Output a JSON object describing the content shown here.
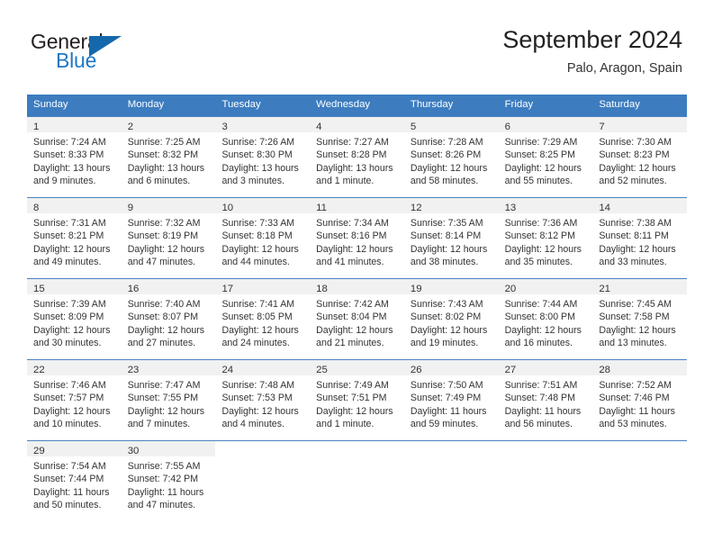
{
  "brand": {
    "name_top": "General",
    "name_bottom": "Blue",
    "triangle_color": "#1668ad",
    "blue_color": "#1f77c4"
  },
  "header": {
    "title": "September 2024",
    "subtitle": "Palo, Aragon, Spain"
  },
  "theme": {
    "header_blue": "#3c7cbf",
    "separator_blue": "#4b83c0",
    "daynum_band": "#f1f1f1",
    "text": "#333333"
  },
  "weekdays": [
    "Sunday",
    "Monday",
    "Tuesday",
    "Wednesday",
    "Thursday",
    "Friday",
    "Saturday"
  ],
  "weeks": [
    [
      {
        "day": "1",
        "sunrise": "Sunrise: 7:24 AM",
        "sunset": "Sunset: 8:33 PM",
        "daylight1": "Daylight: 13 hours",
        "daylight2": "and 9 minutes."
      },
      {
        "day": "2",
        "sunrise": "Sunrise: 7:25 AM",
        "sunset": "Sunset: 8:32 PM",
        "daylight1": "Daylight: 13 hours",
        "daylight2": "and 6 minutes."
      },
      {
        "day": "3",
        "sunrise": "Sunrise: 7:26 AM",
        "sunset": "Sunset: 8:30 PM",
        "daylight1": "Daylight: 13 hours",
        "daylight2": "and 3 minutes."
      },
      {
        "day": "4",
        "sunrise": "Sunrise: 7:27 AM",
        "sunset": "Sunset: 8:28 PM",
        "daylight1": "Daylight: 13 hours",
        "daylight2": "and 1 minute."
      },
      {
        "day": "5",
        "sunrise": "Sunrise: 7:28 AM",
        "sunset": "Sunset: 8:26 PM",
        "daylight1": "Daylight: 12 hours",
        "daylight2": "and 58 minutes."
      },
      {
        "day": "6",
        "sunrise": "Sunrise: 7:29 AM",
        "sunset": "Sunset: 8:25 PM",
        "daylight1": "Daylight: 12 hours",
        "daylight2": "and 55 minutes."
      },
      {
        "day": "7",
        "sunrise": "Sunrise: 7:30 AM",
        "sunset": "Sunset: 8:23 PM",
        "daylight1": "Daylight: 12 hours",
        "daylight2": "and 52 minutes."
      }
    ],
    [
      {
        "day": "8",
        "sunrise": "Sunrise: 7:31 AM",
        "sunset": "Sunset: 8:21 PM",
        "daylight1": "Daylight: 12 hours",
        "daylight2": "and 49 minutes."
      },
      {
        "day": "9",
        "sunrise": "Sunrise: 7:32 AM",
        "sunset": "Sunset: 8:19 PM",
        "daylight1": "Daylight: 12 hours",
        "daylight2": "and 47 minutes."
      },
      {
        "day": "10",
        "sunrise": "Sunrise: 7:33 AM",
        "sunset": "Sunset: 8:18 PM",
        "daylight1": "Daylight: 12 hours",
        "daylight2": "and 44 minutes."
      },
      {
        "day": "11",
        "sunrise": "Sunrise: 7:34 AM",
        "sunset": "Sunset: 8:16 PM",
        "daylight1": "Daylight: 12 hours",
        "daylight2": "and 41 minutes."
      },
      {
        "day": "12",
        "sunrise": "Sunrise: 7:35 AM",
        "sunset": "Sunset: 8:14 PM",
        "daylight1": "Daylight: 12 hours",
        "daylight2": "and 38 minutes."
      },
      {
        "day": "13",
        "sunrise": "Sunrise: 7:36 AM",
        "sunset": "Sunset: 8:12 PM",
        "daylight1": "Daylight: 12 hours",
        "daylight2": "and 35 minutes."
      },
      {
        "day": "14",
        "sunrise": "Sunrise: 7:38 AM",
        "sunset": "Sunset: 8:11 PM",
        "daylight1": "Daylight: 12 hours",
        "daylight2": "and 33 minutes."
      }
    ],
    [
      {
        "day": "15",
        "sunrise": "Sunrise: 7:39 AM",
        "sunset": "Sunset: 8:09 PM",
        "daylight1": "Daylight: 12 hours",
        "daylight2": "and 30 minutes."
      },
      {
        "day": "16",
        "sunrise": "Sunrise: 7:40 AM",
        "sunset": "Sunset: 8:07 PM",
        "daylight1": "Daylight: 12 hours",
        "daylight2": "and 27 minutes."
      },
      {
        "day": "17",
        "sunrise": "Sunrise: 7:41 AM",
        "sunset": "Sunset: 8:05 PM",
        "daylight1": "Daylight: 12 hours",
        "daylight2": "and 24 minutes."
      },
      {
        "day": "18",
        "sunrise": "Sunrise: 7:42 AM",
        "sunset": "Sunset: 8:04 PM",
        "daylight1": "Daylight: 12 hours",
        "daylight2": "and 21 minutes."
      },
      {
        "day": "19",
        "sunrise": "Sunrise: 7:43 AM",
        "sunset": "Sunset: 8:02 PM",
        "daylight1": "Daylight: 12 hours",
        "daylight2": "and 19 minutes."
      },
      {
        "day": "20",
        "sunrise": "Sunrise: 7:44 AM",
        "sunset": "Sunset: 8:00 PM",
        "daylight1": "Daylight: 12 hours",
        "daylight2": "and 16 minutes."
      },
      {
        "day": "21",
        "sunrise": "Sunrise: 7:45 AM",
        "sunset": "Sunset: 7:58 PM",
        "daylight1": "Daylight: 12 hours",
        "daylight2": "and 13 minutes."
      }
    ],
    [
      {
        "day": "22",
        "sunrise": "Sunrise: 7:46 AM",
        "sunset": "Sunset: 7:57 PM",
        "daylight1": "Daylight: 12 hours",
        "daylight2": "and 10 minutes."
      },
      {
        "day": "23",
        "sunrise": "Sunrise: 7:47 AM",
        "sunset": "Sunset: 7:55 PM",
        "daylight1": "Daylight: 12 hours",
        "daylight2": "and 7 minutes."
      },
      {
        "day": "24",
        "sunrise": "Sunrise: 7:48 AM",
        "sunset": "Sunset: 7:53 PM",
        "daylight1": "Daylight: 12 hours",
        "daylight2": "and 4 minutes."
      },
      {
        "day": "25",
        "sunrise": "Sunrise: 7:49 AM",
        "sunset": "Sunset: 7:51 PM",
        "daylight1": "Daylight: 12 hours",
        "daylight2": "and 1 minute."
      },
      {
        "day": "26",
        "sunrise": "Sunrise: 7:50 AM",
        "sunset": "Sunset: 7:49 PM",
        "daylight1": "Daylight: 11 hours",
        "daylight2": "and 59 minutes."
      },
      {
        "day": "27",
        "sunrise": "Sunrise: 7:51 AM",
        "sunset": "Sunset: 7:48 PM",
        "daylight1": "Daylight: 11 hours",
        "daylight2": "and 56 minutes."
      },
      {
        "day": "28",
        "sunrise": "Sunrise: 7:52 AM",
        "sunset": "Sunset: 7:46 PM",
        "daylight1": "Daylight: 11 hours",
        "daylight2": "and 53 minutes."
      }
    ],
    [
      {
        "day": "29",
        "sunrise": "Sunrise: 7:54 AM",
        "sunset": "Sunset: 7:44 PM",
        "daylight1": "Daylight: 11 hours",
        "daylight2": "and 50 minutes."
      },
      {
        "day": "30",
        "sunrise": "Sunrise: 7:55 AM",
        "sunset": "Sunset: 7:42 PM",
        "daylight1": "Daylight: 11 hours",
        "daylight2": "and 47 minutes."
      },
      {
        "day": "",
        "sunrise": "",
        "sunset": "",
        "daylight1": "",
        "daylight2": ""
      },
      {
        "day": "",
        "sunrise": "",
        "sunset": "",
        "daylight1": "",
        "daylight2": ""
      },
      {
        "day": "",
        "sunrise": "",
        "sunset": "",
        "daylight1": "",
        "daylight2": ""
      },
      {
        "day": "",
        "sunrise": "",
        "sunset": "",
        "daylight1": "",
        "daylight2": ""
      },
      {
        "day": "",
        "sunrise": "",
        "sunset": "",
        "daylight1": "",
        "daylight2": ""
      }
    ]
  ]
}
